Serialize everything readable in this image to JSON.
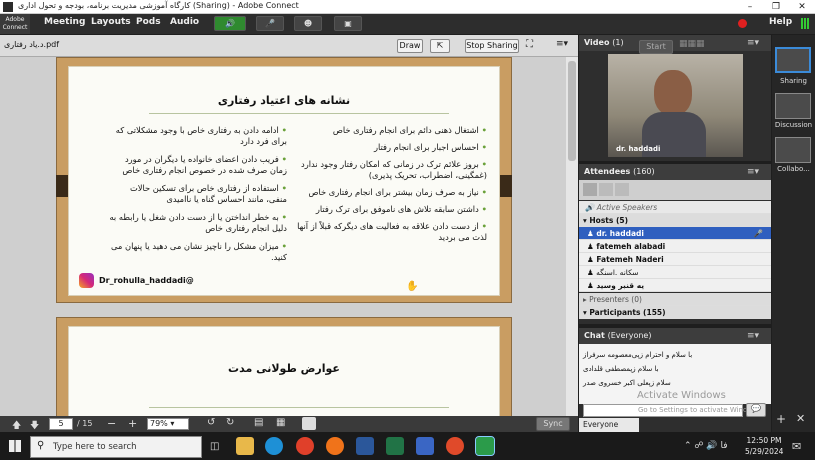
{
  "window": {
    "title": "کارگاه آموزشی مدیریت برنامه، بودجه و تحول اداری (Sharing) - Adobe Connect"
  },
  "logo": {
    "line1": "Adobe",
    "line2": "Connect"
  },
  "menu": [
    "Meeting",
    "Layouts",
    "Pods",
    "Audio"
  ],
  "help": "Help",
  "share_pod": {
    "filename": "د.یاد رفتاری.pdf",
    "draw": "Draw",
    "stop": "Stop Sharing"
  },
  "slide1": {
    "title": "نشانه های اعتیاد رفتاری",
    "right_items": [
      "اشتغال ذهنی دائم برای انجام رفتاری خاص",
      "احساس اجبار برای انجام رفتار",
      "بروز علائم ترک در زمانی که امکان رفتار وجود ندارد (غمگینی، اضطراب، تحریک پذیری)",
      "نیاز به صرف زمان بیشتر برای انجام رفتاری خاص",
      "داشتن سابقه تلاش های ناموفق برای ترک رفتار",
      "از دست دادن علاقه به فعالیت های دیگرکه قبلاً از آنها لذت می بردید"
    ],
    "left_items": [
      "ادامه دادن به رفتاری خاص با وجود مشکلاتی که برای فرد دارد",
      "فریب دادن اعضای خانواده یا دیگران در مورد زمان صرف شده در خصوص انجام رفتاری خاص",
      "استفاده از رفتاری خاص برای تسکین حالات منفی، مانند احساس گناه یا ناامیدی",
      "به خطر انداختن یا از دست دادن شغل یا رابطه به دلیل انجام رفتاری خاص",
      "میزان مشکل را ناچیز نشان می دهید یا پنهان می کنید."
    ],
    "instagram": "Dr_rohulla_haddadi@"
  },
  "slide2": {
    "title": "عوارض طولانی مدت"
  },
  "nav": {
    "page": "5",
    "total": "/ 15",
    "zoom": "79%",
    "sync": "Sync"
  },
  "video": {
    "title": "Video",
    "count": "(1)",
    "start": "Start",
    "name": "dr. haddadi"
  },
  "attendees": {
    "title": "Attendees",
    "count": "(160)",
    "active_speakers": "Active Speakers",
    "hosts_label": "Hosts (5)",
    "hosts": [
      "dr. haddadi",
      "fatemeh alabadi",
      "Fatemeh Naderi",
      "سکانه .اسنگه",
      "یه قنبر وسید"
    ],
    "presenters": "Presenters (0)",
    "participants": "Participants (155)"
  },
  "chat": {
    "title": "Chat",
    "scope": "(Everyone)",
    "messages": [
      "با سلام و احترام زپی‌معصومه سرفراز",
      "با سلام زپمصطفی قلدادی",
      "سلام زپعلی اکبر خسروی صدر"
    ],
    "recipient": "Everyone",
    "activate1": "Activate Windows",
    "activate2": "Go to Settings to activate Windows."
  },
  "layouts": [
    "Sharing",
    "Discussion",
    "Collabo..."
  ],
  "taskbar": {
    "search": "Type here to search",
    "time": "12:50 PM",
    "date": "5/29/2024"
  },
  "colors": {
    "accent": "#1f6fc8",
    "slide_frame": "#c99d62",
    "bullet": "#6aa13a",
    "highlight": "#2f5fbf"
  }
}
